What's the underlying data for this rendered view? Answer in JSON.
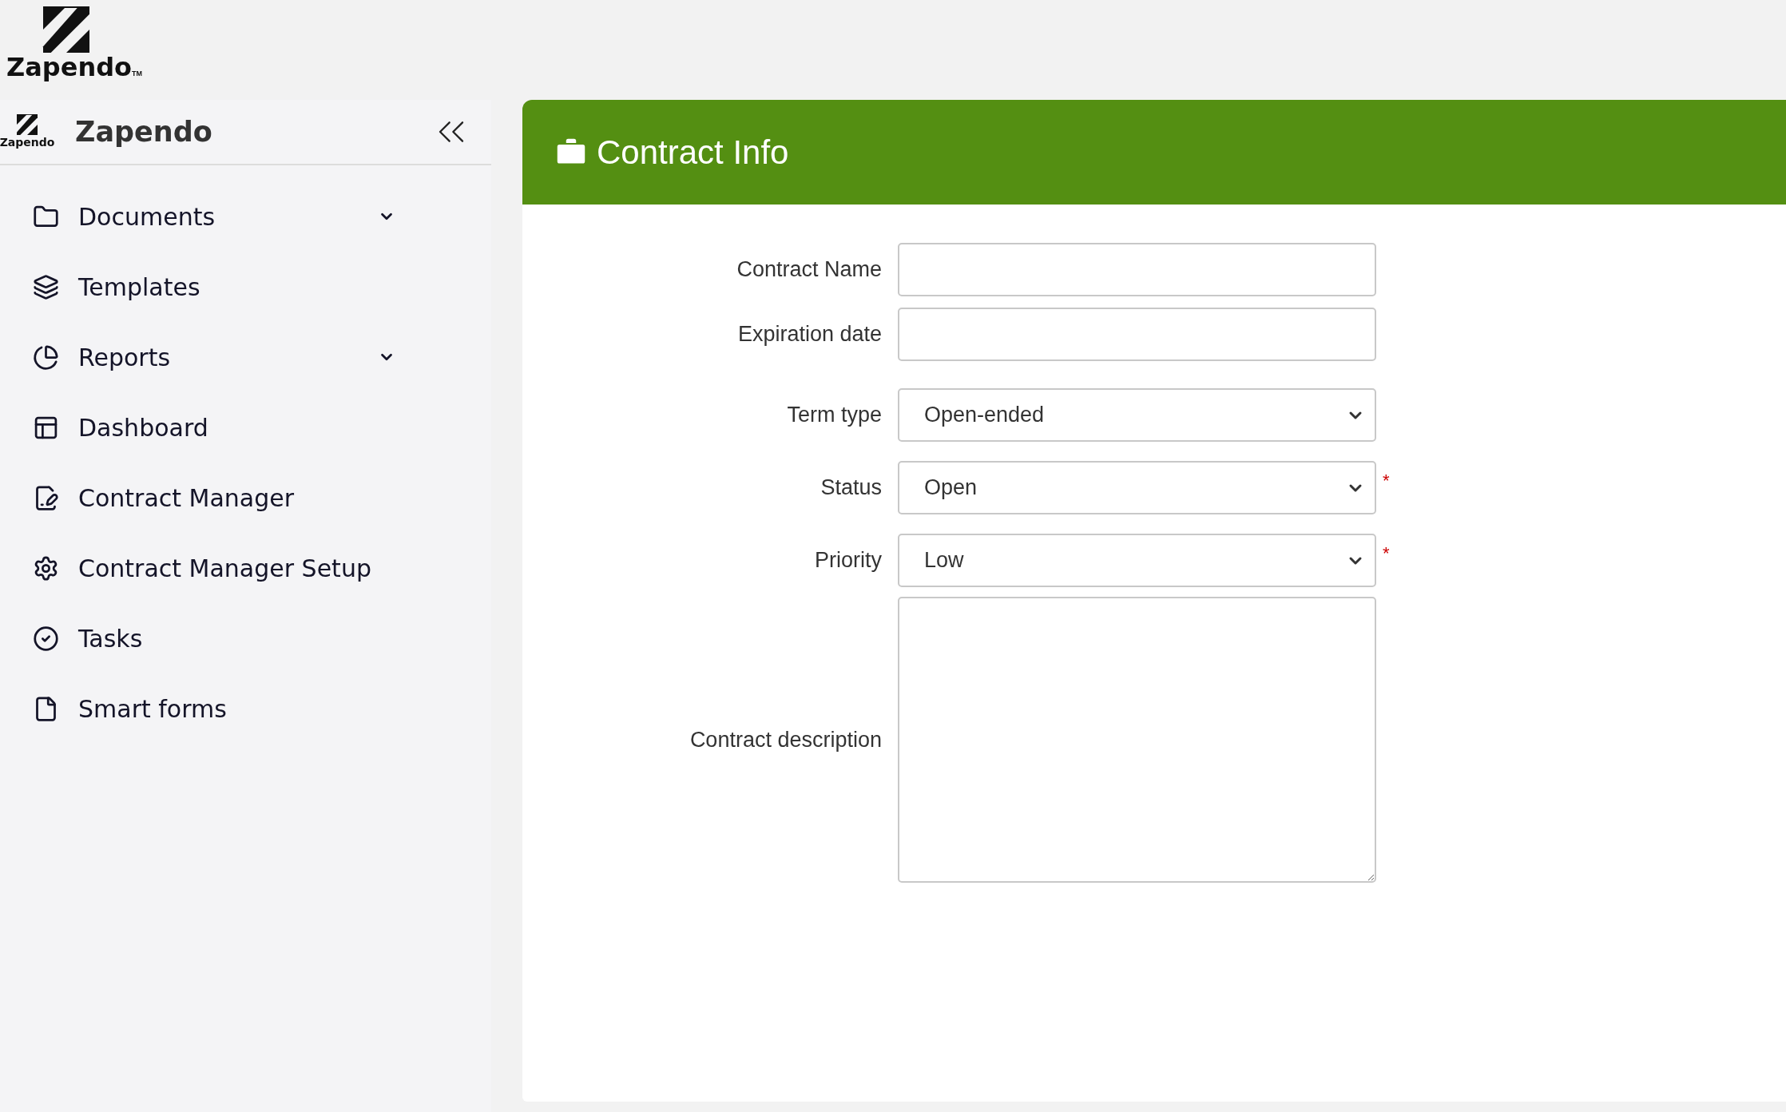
{
  "brand": {
    "name": "Zapendo",
    "trademark": "TM"
  },
  "sidebar": {
    "logo_text": "Zapendo",
    "title": "Zapendo",
    "items": [
      {
        "label": "Documents",
        "submenu": true
      },
      {
        "label": "Templates",
        "submenu": false
      },
      {
        "label": "Reports",
        "submenu": true
      },
      {
        "label": "Dashboard",
        "submenu": false
      },
      {
        "label": "Contract Manager",
        "submenu": false
      },
      {
        "label": "Contract Manager Setup",
        "submenu": false
      },
      {
        "label": "Tasks",
        "submenu": false
      },
      {
        "label": "Smart forms",
        "submenu": false
      }
    ]
  },
  "panel": {
    "title": "Contract Info",
    "fields": [
      {
        "kind": "text",
        "label": "Contract Name"
      },
      {
        "kind": "text",
        "label": "Expiration date"
      },
      {
        "kind": "select",
        "label": "Term type",
        "value": "Open-ended"
      },
      {
        "kind": "select",
        "label": "Status",
        "value": "Open",
        "required_mark": "*"
      },
      {
        "kind": "select",
        "label": "Priority",
        "value": "Low",
        "required_mark": "*"
      },
      {
        "kind": "textarea",
        "label": "Contract description"
      }
    ]
  }
}
